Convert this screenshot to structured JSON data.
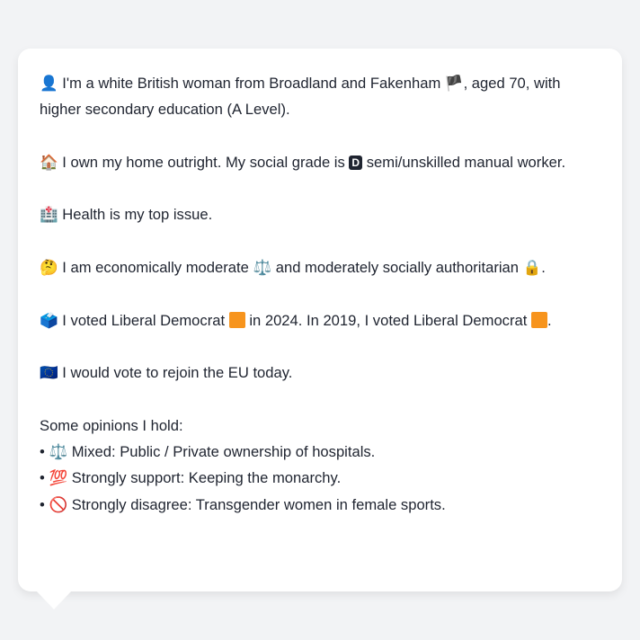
{
  "profile": {
    "intro": {
      "icon": "👤",
      "text1": "I'm a white British woman from Broadland and Fakenham",
      "flag": "🏴",
      "text2": ", aged 70, with higher secondary education (A Level)."
    },
    "home": {
      "icon": "🏠",
      "text1": "I own my home outright. My social grade is",
      "grade": "D",
      "text2": "semi/unskilled manual worker."
    },
    "issue": {
      "icon": "🏥",
      "text": "Health is my top issue."
    },
    "ideology": {
      "icon": "🤔",
      "text1": "I am economically moderate",
      "icon2": "⚖️",
      "text2": "and moderately socially authoritarian",
      "icon3": "🔒",
      "text3": "."
    },
    "votes": {
      "icon": "🗳️",
      "text1": "I voted Liberal Democrat",
      "text2": "in 2024. In 2019, I voted Liberal Democrat",
      "text3": ".",
      "party_color": "#f7941d"
    },
    "eu": {
      "icon": "🇪🇺",
      "text": "I would vote to rejoin the EU today."
    },
    "opinions_heading": "Some opinions I hold:",
    "opinions": [
      {
        "bullet": "•",
        "icon": "⚖️",
        "text": "Mixed: Public / Private ownership of hospitals."
      },
      {
        "bullet": "•",
        "icon": "💯",
        "text": "Strongly support: Keeping the monarchy."
      },
      {
        "bullet": "•",
        "icon": "🚫",
        "text": "Strongly disagree: Transgender women in female sports."
      }
    ]
  }
}
